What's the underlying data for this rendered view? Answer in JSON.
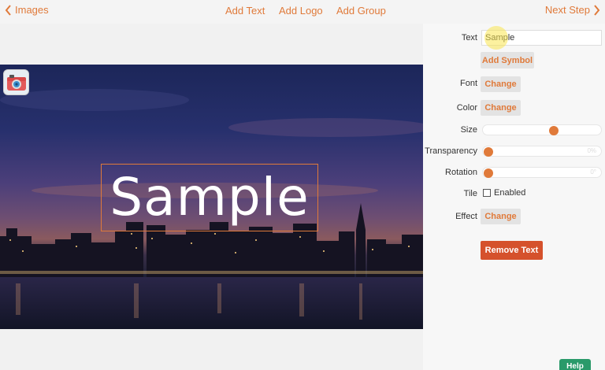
{
  "topbar": {
    "back_label": "Images",
    "next_label": "Next Step",
    "links": [
      "Add Text",
      "Add Logo",
      "Add Group"
    ]
  },
  "canvas": {
    "overlay_text": "Sample"
  },
  "panel": {
    "text_label": "Text",
    "text_value": "Sample",
    "add_symbol_label": "Add Symbol",
    "font_label": "Font",
    "font_button": "Change",
    "color_label": "Color",
    "color_button": "Change",
    "size_label": "Size",
    "size_value": 0.6,
    "transparency_label": "Transparency",
    "transparency_value": 0,
    "transparency_readout": "0%",
    "rotation_label": "Rotation",
    "rotation_value": 0,
    "rotation_readout": "0°",
    "tile_label": "Tile",
    "tile_checkbox_label": "Enabled",
    "tile_enabled": false,
    "effect_label": "Effect",
    "effect_button": "Change",
    "remove_text_label": "Remove Text"
  },
  "help_label": "Help",
  "colors": {
    "accent": "#e07a3a",
    "remove": "#d5512c",
    "help": "#2a9a6a"
  }
}
